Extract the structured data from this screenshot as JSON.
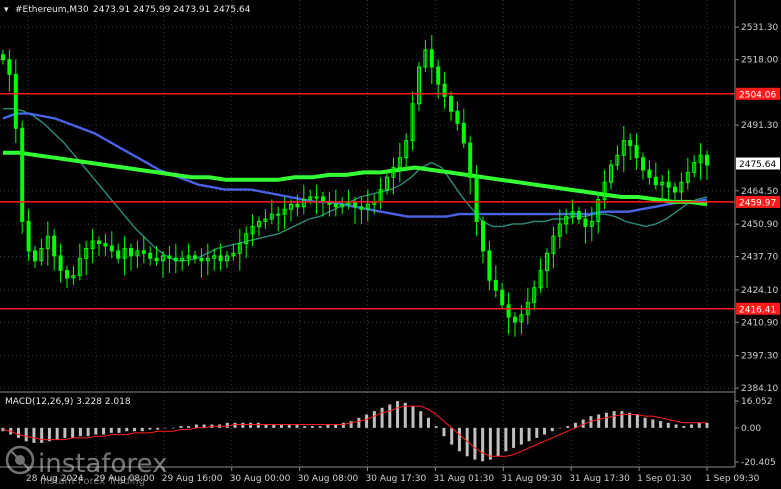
{
  "header": {
    "symbol_title": "#Ethereum,M30",
    "ohlc": "2473.91 2475.99 2473.91 2475.64"
  },
  "watermark": {
    "brand": "instaforex",
    "tagline": "Instant Forex Trading"
  },
  "colors": {
    "background": "#000000",
    "candle": "#00ff00",
    "ma_fast": "#2e8b7a",
    "ma_mid": "#4a63e6",
    "ma_slow": "#33ff33",
    "level_line": "#ff1a1a",
    "macd_hist": "#c0c0c0",
    "macd_signal": "#ff2020",
    "grid": "#3a3a3a",
    "current_price_bg": "#ffffff"
  },
  "chart_data": [
    {
      "type": "candlestick",
      "title": "#Ethereum,M30",
      "ylim": [
        2384.1,
        2531.3
      ],
      "yticks": [
        {
          "value": 2531.3,
          "label": "2531.30"
        },
        {
          "value": 2518.0,
          "label": "2518.00"
        },
        {
          "value": 2491.3,
          "label": "2491.30"
        },
        {
          "value": 2464.5,
          "label": "2464.50"
        },
        {
          "value": 2450.9,
          "label": "2450.90"
        },
        {
          "value": 2437.7,
          "label": "2437.70"
        },
        {
          "value": 2424.1,
          "label": "2424.10"
        },
        {
          "value": 2410.9,
          "label": "2410.90"
        },
        {
          "value": 2397.3,
          "label": "2397.30"
        },
        {
          "value": 2384.1,
          "label": "2384.10"
        }
      ],
      "xticks": [
        "28 Aug 2024",
        "29 Aug 08:00",
        "29 Aug 16:00",
        "30 Aug 00:00",
        "30 Aug 08:00",
        "30 Aug 17:30",
        "31 Aug 01:30",
        "31 Aug 09:30",
        "31 Aug 17:30",
        "1 Sep 01:30",
        "1 Sep 09:30"
      ],
      "levels": [
        {
          "value": 2504.06,
          "label": "2504.06"
        },
        {
          "value": 2459.97,
          "label": "2459.97"
        },
        {
          "value": 2416.41,
          "label": "2416.41"
        }
      ],
      "current_price": {
        "value": 2475.64,
        "label": "2475.64"
      },
      "close_series": [
        2518,
        2512,
        2490,
        2452,
        2440,
        2436,
        2441,
        2446,
        2438,
        2432,
        2429,
        2430,
        2437,
        2441,
        2444,
        2443,
        2442,
        2440,
        2437,
        2441,
        2438,
        2440,
        2439,
        2437,
        2436,
        2438,
        2437,
        2436,
        2437,
        2438,
        2437,
        2436,
        2437,
        2438,
        2436,
        2438,
        2439,
        2443,
        2447,
        2450,
        2452,
        2453,
        2455,
        2455,
        2457,
        2459,
        2458,
        2461,
        2462,
        2462,
        2460,
        2459,
        2458,
        2459,
        2460,
        2458,
        2457,
        2459,
        2460,
        2465,
        2470,
        2474,
        2478,
        2485,
        2500,
        2515,
        2522,
        2515,
        2508,
        2503,
        2497,
        2492,
        2484,
        2470,
        2452,
        2440,
        2428,
        2424,
        2418,
        2413,
        2411,
        2414,
        2419,
        2425,
        2432,
        2439,
        2446,
        2451,
        2454,
        2456,
        2453,
        2450,
        2452,
        2461,
        2468,
        2475,
        2479,
        2485,
        2483,
        2478,
        2473,
        2470,
        2467,
        2468,
        2466,
        2464,
        2468,
        2472,
        2476,
        2479,
        2475
      ],
      "ma_fast": [
        2498,
        2498,
        2497,
        2495,
        2492,
        2488,
        2484,
        2479,
        2474,
        2469,
        2464,
        2459,
        2454,
        2449,
        2445,
        2441,
        2438,
        2436,
        2436,
        2437,
        2439,
        2441,
        2442,
        2443,
        2444,
        2445,
        2446,
        2447,
        2449,
        2451,
        2453,
        2454,
        2456,
        2458,
        2460,
        2462,
        2463,
        2464,
        2465,
        2467,
        2470,
        2474,
        2476,
        2474,
        2468,
        2462,
        2457,
        2452,
        2450,
        2450,
        2451,
        2451,
        2452,
        2452,
        2453,
        2453,
        2454,
        2454,
        2455,
        2455,
        2454,
        2452,
        2451,
        2450,
        2451,
        2453,
        2456,
        2459,
        2461,
        2462
      ],
      "ma_mid": [
        2494,
        2496,
        2496,
        2495,
        2494,
        2492,
        2490,
        2488,
        2485,
        2482,
        2479,
        2476,
        2473,
        2471,
        2469,
        2467,
        2466,
        2465,
        2465,
        2465,
        2464,
        2463,
        2462,
        2461,
        2460,
        2460,
        2459,
        2458,
        2457,
        2456,
        2455,
        2454,
        2454,
        2454,
        2454,
        2455,
        2455,
        2455,
        2455,
        2455,
        2455,
        2455,
        2455,
        2455,
        2455,
        2455,
        2456,
        2456,
        2456,
        2457,
        2458,
        2459,
        2460,
        2460,
        2461
      ],
      "ma_slow": [
        2480,
        2480,
        2479,
        2478,
        2477,
        2476,
        2475,
        2474,
        2473,
        2472,
        2471,
        2470,
        2470,
        2469,
        2469,
        2469,
        2469,
        2470,
        2470,
        2471,
        2471,
        2472,
        2472,
        2473,
        2474,
        2473,
        2472,
        2471,
        2470,
        2469,
        2468,
        2467,
        2466,
        2465,
        2464,
        2463,
        2462,
        2462,
        2461,
        2460,
        2460,
        2459
      ]
    },
    {
      "type": "bar",
      "title": "MACD(12,26,9) 3.228 2.018",
      "ylim": [
        -20.405,
        16.052
      ],
      "yticks": [
        {
          "value": 16.052,
          "label": "16.052"
        },
        {
          "value": 0.0,
          "label": "0.00"
        },
        {
          "value": -20.405,
          "label": "-20.405"
        }
      ],
      "histogram": [
        -2,
        -4,
        -6,
        -8,
        -9,
        -9,
        -8,
        -7,
        -6,
        -6,
        -5,
        -5,
        -4,
        -4,
        -3,
        -3,
        -2,
        -2,
        -2,
        -1,
        -1,
        0,
        0,
        1,
        1,
        2,
        2,
        2,
        2,
        3,
        3,
        3,
        3,
        3,
        2,
        2,
        2,
        2,
        2,
        1,
        1,
        1,
        2,
        2,
        3,
        4,
        6,
        8,
        10,
        12,
        14,
        16,
        15,
        13,
        10,
        6,
        1,
        -5,
        -10,
        -14,
        -17,
        -19,
        -20,
        -19,
        -17,
        -14,
        -12,
        -10,
        -8,
        -6,
        -4,
        -2,
        0,
        1,
        3,
        5,
        7,
        8,
        9,
        10,
        10,
        9,
        8,
        6,
        5,
        4,
        3,
        2,
        1,
        2,
        3,
        3
      ],
      "signal": [
        -1,
        -2,
        -4,
        -5,
        -6,
        -7,
        -7,
        -7,
        -7,
        -6,
        -6,
        -6,
        -5,
        -5,
        -4,
        -4,
        -4,
        -3,
        -3,
        -3,
        -2,
        -2,
        -2,
        -1,
        -1,
        0,
        0,
        1,
        1,
        1,
        2,
        2,
        2,
        2,
        2,
        2,
        2,
        2,
        2,
        2,
        2,
        2,
        2,
        2,
        2,
        3,
        4,
        5,
        7,
        9,
        10,
        12,
        13,
        13,
        13,
        11,
        8,
        4,
        0,
        -4,
        -8,
        -12,
        -15,
        -17,
        -17,
        -17,
        -16,
        -14,
        -12,
        -10,
        -8,
        -6,
        -4,
        -2,
        0,
        2,
        4,
        5,
        6,
        7,
        8,
        8,
        8,
        7,
        7,
        6,
        5,
        4,
        3,
        3,
        3,
        3
      ]
    }
  ]
}
